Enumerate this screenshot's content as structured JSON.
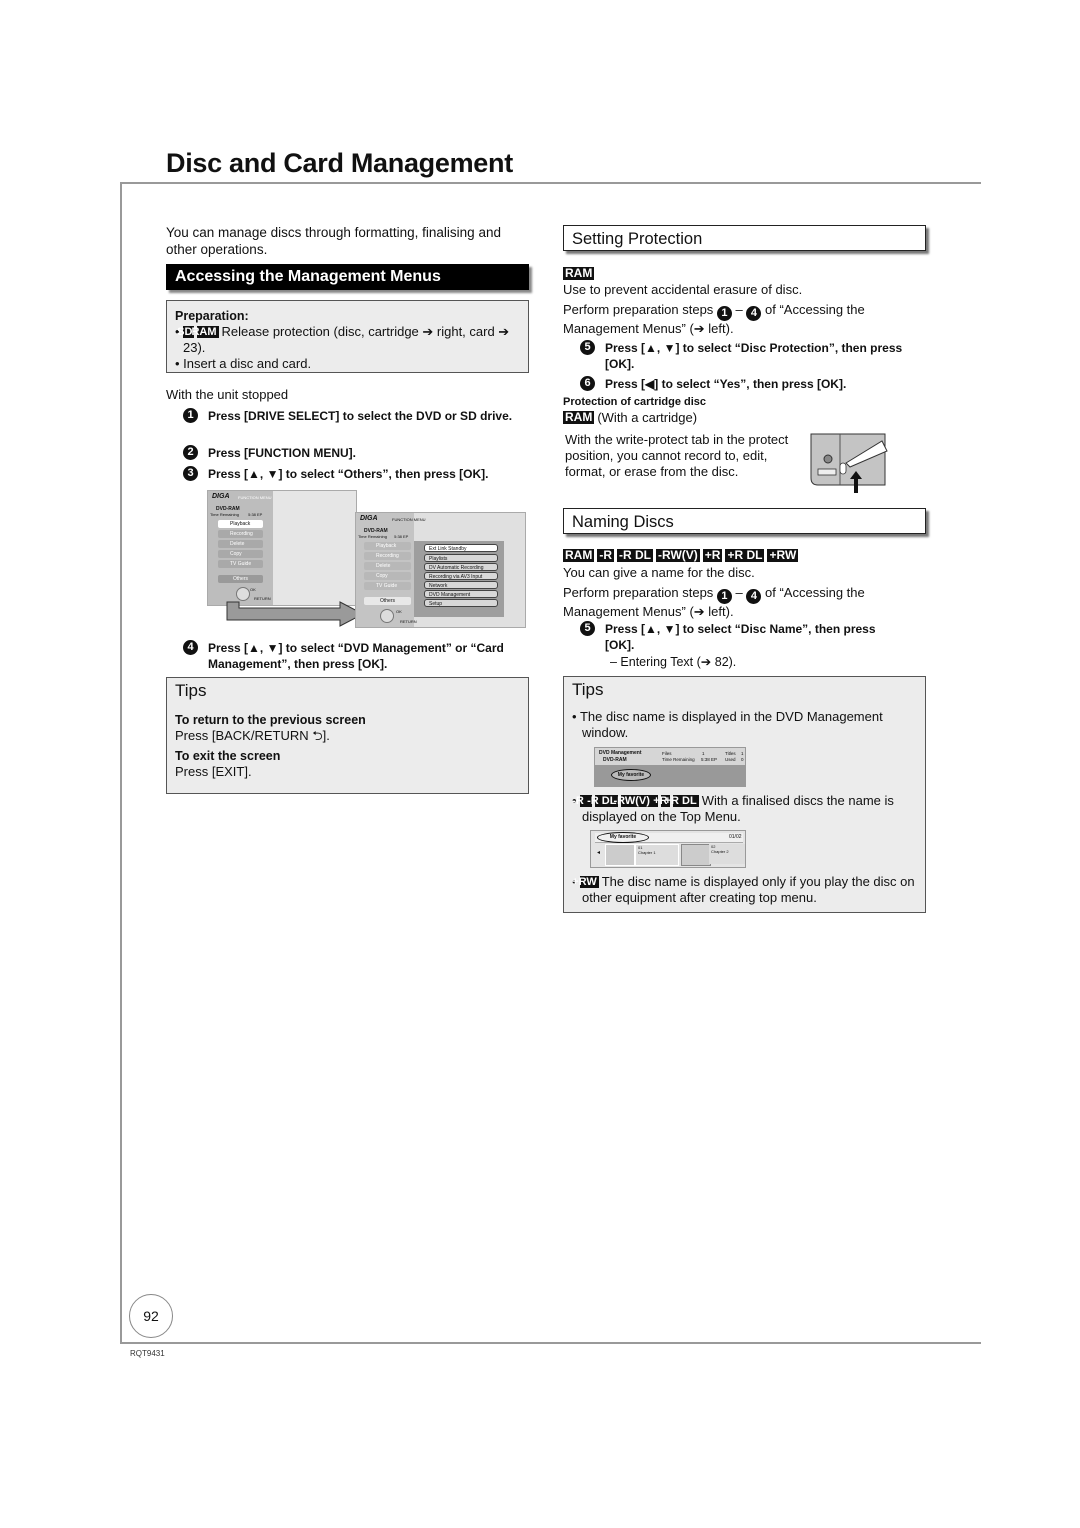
{
  "page": {
    "title": "Disc and Card Management",
    "page_number": "92",
    "doc_code": "RQT9431"
  },
  "left": {
    "intro": "You can manage discs through formatting, finalising and other operations.",
    "section_title": "Accessing the Management Menus",
    "preparation": {
      "heading": "Preparation:",
      "item1_tags": [
        "SD",
        "RAM"
      ],
      "item1_text": "Release protection (disc, cartridge ➔ right, card ➔ 23).",
      "item2_text": "Insert a disc and card."
    },
    "with_unit_stopped": "With the unit stopped",
    "steps": [
      {
        "num": "1",
        "text": "Press [DRIVE SELECT] to select the DVD or SD drive."
      },
      {
        "num": "2",
        "text": "Press [FUNCTION MENU]."
      },
      {
        "num": "3",
        "text": "Press [▲, ▼] to select “Others”, then press [OK]."
      },
      {
        "num": "4",
        "text": "Press [▲, ▼] to select “DVD Management” or “Card Management”, then press [OK]."
      }
    ],
    "screen1": {
      "brand": "DIGA",
      "menu_title": "FUNCTION MENU",
      "disc": "DVD-RAM",
      "time_remaining_label": "Time Remaining",
      "time_remaining": "5:38 EP",
      "items": [
        "Playback",
        "Recording",
        "Delete",
        "Copy",
        "TV Guide"
      ],
      "others": "Others",
      "ok": "OK",
      "return": "RETURN"
    },
    "screen2": {
      "brand": "DIGA",
      "menu_title": "FUNCTION MENU",
      "disc": "DVD-RAM",
      "time_remaining_label": "Time Remaining",
      "time_remaining": "5:38 EP",
      "items": [
        "Playback",
        "Recording",
        "Delete",
        "Copy",
        "TV Guide"
      ],
      "others": "Others",
      "submenu": [
        "Ext Link Standby",
        "Playlists",
        "DV Automatic Recording",
        "Recording via AV3 Input",
        "Network",
        "DVD Management",
        "Setup"
      ],
      "ok": "OK",
      "return": "RETURN"
    },
    "tips": {
      "title": "Tips",
      "h1": "To return to the previous screen",
      "t1": "Press [BACK/RETURN ⮌].",
      "h2": "To exit the screen",
      "t2": "Press [EXIT]."
    }
  },
  "right": {
    "protection": {
      "title": "Setting Protection",
      "tag": "RAM",
      "desc": "Use to prevent accidental erasure of disc.",
      "perform": "Perform preparation steps",
      "perform_from": "1",
      "perform_to": "4",
      "perform_rest": "of “Accessing the Management Menus” (➔ left).",
      "steps": [
        {
          "num": "5",
          "text": "Press [▲, ▼] to select “Disc Protection”, then press [OK]."
        },
        {
          "num": "6",
          "text": "Press [◀] to select “Yes”, then press [OK]."
        }
      ],
      "cartridge_heading": "Protection of cartridge disc",
      "cartridge_tag": "RAM",
      "cartridge_note": "(With a cartridge)",
      "cartridge_text": "With the write-protect tab in the protect position, you cannot record to, edit, format, or erase from the disc."
    },
    "naming": {
      "title": "Naming Discs",
      "tags": [
        "RAM",
        "-R",
        "-R DL",
        "-RW(V)",
        "+R",
        "+R DL",
        "+RW"
      ],
      "desc": "You can give a name for the disc.",
      "perform": "Perform preparation steps",
      "perform_from": "1",
      "perform_to": "4",
      "perform_rest": "of “Accessing the Management Menus” (➔ left).",
      "step": {
        "num": "5",
        "text": "Press [▲, ▼] to select “Disc Name”, then press [OK]."
      },
      "entering": "– Entering Text (➔ 82)."
    },
    "tips": {
      "title": "Tips",
      "b1": "The disc name is displayed in the DVD Management window.",
      "shot1": {
        "title": "DVD Management",
        "disc": "DVD-RAM",
        "files_label": "Files",
        "files": "1",
        "time_label": "Time Remaining",
        "time": "5:38 EP",
        "titles_label": "Titles",
        "titles": "1",
        "used_label": "Used",
        "used": "0",
        "name": "My favorite"
      },
      "b2_tags": [
        "-R",
        "-R DL",
        "-RW(V)",
        "+R",
        "+R DL"
      ],
      "b2": "With a finalised discs the name is displayed on the Top Menu.",
      "shot2": {
        "name": "My favorite",
        "page": "01/02",
        "ch1_num": "01",
        "ch1": "Chapter 1",
        "ch2_num": "02",
        "ch2": "Chapter 2"
      },
      "b3_tag": "+RW",
      "b3": "The disc name is displayed only if you play the disc on other equipment after creating top menu."
    }
  }
}
